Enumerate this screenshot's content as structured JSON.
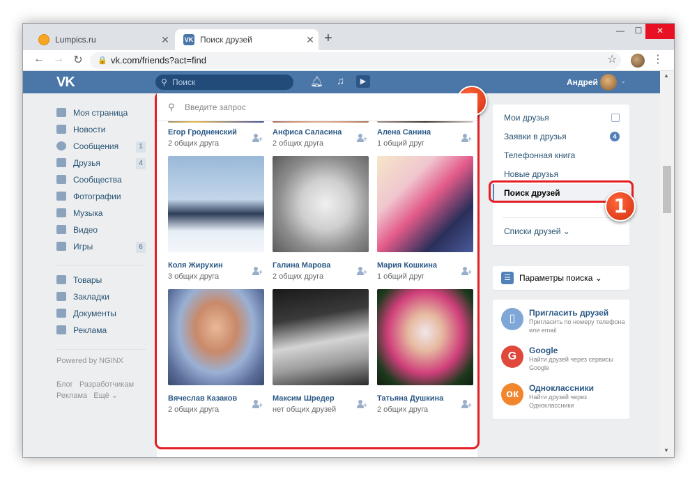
{
  "browser": {
    "tabs": [
      {
        "title": "Lumpics.ru",
        "close": "✕"
      },
      {
        "title": "Поиск друзей",
        "close": "✕"
      }
    ],
    "new_tab": "+",
    "url": "vk.com/friends?act=find",
    "window_controls": {
      "minimize": "—",
      "maximize": "☐",
      "close": "✕"
    }
  },
  "vk_header": {
    "logo": "VK",
    "search_placeholder": "Поиск",
    "user_name": "Андрей"
  },
  "left_menu": {
    "items": [
      {
        "label": "Моя страница",
        "count": ""
      },
      {
        "label": "Новости",
        "count": ""
      },
      {
        "label": "Сообщения",
        "count": "1"
      },
      {
        "label": "Друзья",
        "count": "4"
      },
      {
        "label": "Сообщества",
        "count": ""
      },
      {
        "label": "Фотографии",
        "count": ""
      },
      {
        "label": "Музыка",
        "count": ""
      },
      {
        "label": "Видео",
        "count": ""
      },
      {
        "label": "Игры",
        "count": "6"
      }
    ],
    "items2": [
      {
        "label": "Товары"
      },
      {
        "label": "Закладки"
      },
      {
        "label": "Документы"
      },
      {
        "label": "Реклама"
      }
    ],
    "powered": "Powered by NGINX",
    "footer_links": [
      "Блог",
      "Разработчикам",
      "Реклама",
      "Ещё ⌄"
    ]
  },
  "search": {
    "placeholder": "Введите запрос"
  },
  "friends": [
    {
      "name": "Егор Гродненский",
      "mutual": "2 общих друга"
    },
    {
      "name": "Анфиса Саласина",
      "mutual": "2 общих друга"
    },
    {
      "name": "Алена Санина",
      "mutual": "1 общий друг"
    },
    {
      "name": "Коля Жирухин",
      "mutual": "3 общих друга"
    },
    {
      "name": "Галина Марова",
      "mutual": "2 общих друга"
    },
    {
      "name": "Мария Кошкина",
      "mutual": "1 общий друг"
    },
    {
      "name": "Вячеслав Казаков",
      "mutual": "2 общих друга"
    },
    {
      "name": "Максим Шредер",
      "mutual": "нет общих друзей"
    },
    {
      "name": "Татьяна Душкина",
      "mutual": "2 общих друга"
    }
  ],
  "right_menu": {
    "items": [
      {
        "label": "Мои друзья"
      },
      {
        "label": "Заявки в друзья",
        "count": "4"
      },
      {
        "label": "Телефонная книга"
      },
      {
        "label": "Новые друзья"
      },
      {
        "label": "Поиск друзей"
      },
      {
        "label": "Списки друзей ⌄"
      }
    ],
    "params_label": "Параметры поиска ⌄"
  },
  "invite": [
    {
      "title": "Пригласить друзей",
      "desc": "Пригласить по номеру телефона или email",
      "icon": "phone-icon",
      "color": "#7ea6d6"
    },
    {
      "title": "Google",
      "desc": "Найти друзей через сервисы Google",
      "icon": "google-icon",
      "color": "#e0483c"
    },
    {
      "title": "Одноклассники",
      "desc": "Найти друзей через Одноклассники",
      "icon": "ok-icon",
      "color": "#f2862e"
    }
  ],
  "annotations": {
    "badge1": "1",
    "badge2": "2"
  },
  "colors": {
    "vk_blue": "#4a76a8",
    "annotation_red": "#e31e24",
    "link": "#2a5885"
  }
}
